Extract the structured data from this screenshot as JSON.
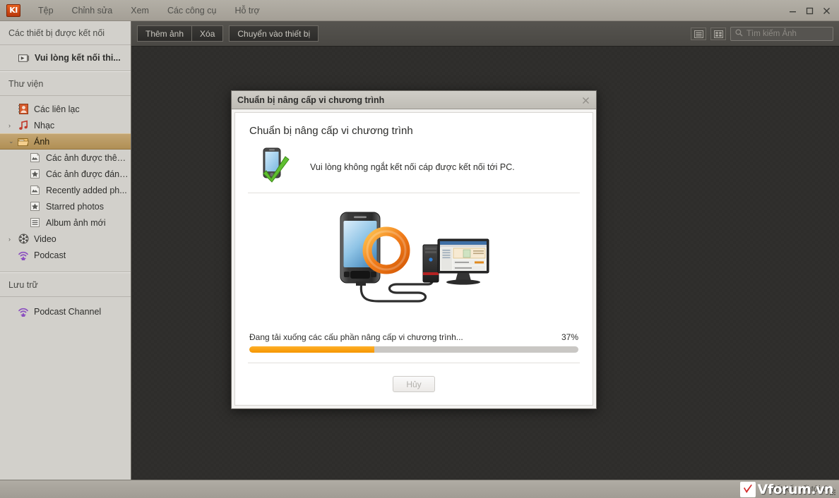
{
  "window": {
    "app_logo_text": "KI",
    "menu": [
      "Tệp",
      "Chỉnh sửa",
      "Xem",
      "Các công cụ",
      "Hỗ trợ"
    ],
    "controls": {
      "minimize": "—",
      "maximize": "▢",
      "close": "✕"
    }
  },
  "sidebar": {
    "devices_header": "Các thiết bị được kết nối",
    "device_item": "Vui lòng kết nối thi...",
    "library_header": "Thư viện",
    "library_items": [
      {
        "label": "Các liên lạc",
        "icon": "contacts-icon",
        "caret": "",
        "child": false,
        "selected": false
      },
      {
        "label": "Nhạc",
        "icon": "music-icon",
        "caret": "›",
        "child": false,
        "selected": false
      },
      {
        "label": "Ảnh",
        "icon": "photos-icon",
        "caret": "⌄",
        "child": false,
        "selected": true
      },
      {
        "label": "Các ảnh được thêm...",
        "icon": "photo-icon",
        "caret": "",
        "child": true,
        "selected": false
      },
      {
        "label": "Các ảnh được đánh...",
        "icon": "star-icon",
        "caret": "",
        "child": true,
        "selected": false
      },
      {
        "label": "Recently added ph...",
        "icon": "photo-icon",
        "caret": "",
        "child": true,
        "selected": false
      },
      {
        "label": "Starred photos",
        "icon": "star-icon",
        "caret": "",
        "child": true,
        "selected": false
      },
      {
        "label": "Album ảnh mới",
        "icon": "list-icon",
        "caret": "",
        "child": true,
        "selected": false
      },
      {
        "label": "Video",
        "icon": "video-icon",
        "caret": "›",
        "child": false,
        "selected": false
      },
      {
        "label": "Podcast",
        "icon": "podcast-icon",
        "caret": "",
        "child": false,
        "selected": false
      }
    ],
    "storage_header": "Lưu trữ",
    "storage_items": [
      {
        "label": "Podcast Channel",
        "icon": "podcast-icon"
      }
    ]
  },
  "toolbar": {
    "add_photo_label": "Thêm ảnh",
    "delete_label": "Xóa",
    "transfer_label": "Chuyển vào thiết bị",
    "list_view_icon": "list-view-icon",
    "grid_view_icon": "grid-view-icon",
    "search_placeholder": "Tìm kiếm Ảnh",
    "search_value": "",
    "search_icon": "search-icon"
  },
  "dialog": {
    "title": "Chuẩn bị nâng cấp vi chương trình",
    "close_icon": "close-icon",
    "heading": "Chuẩn bị nâng cấp vi chương trình",
    "notice": "Vui lòng không ngắt kết nối cáp được kết nối tới PC.",
    "notice_icon": "phone-checkmark-icon",
    "illustration_icon": "phone-pc-sync-illustration",
    "progress_label": "Đang tải xuống các cấu phần nâng cấp vi chương trình...",
    "progress_percent_text": "37%",
    "progress_percent": 37,
    "cancel_label": "Hủy"
  },
  "statusbar": {
    "message": "Mất kết nối tới G",
    "watermark": "Vforum.vn"
  },
  "colors": {
    "accent_orange": "#f59600",
    "selection_tan": "#b89a6a",
    "chrome_grey": "#a8a49c",
    "canvas_dark": "#2e2d2b"
  }
}
